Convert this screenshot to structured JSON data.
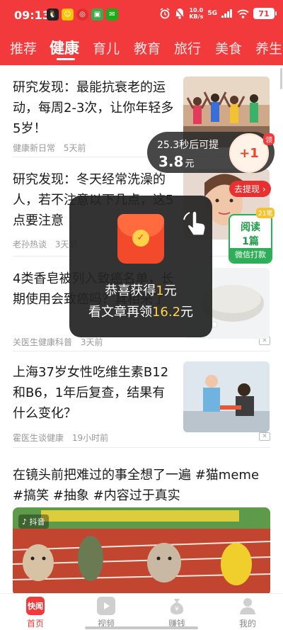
{
  "status_bar": {
    "time": "09:13",
    "speed_value": "10.0",
    "speed_unit": "KB/s",
    "signal": "5G",
    "battery": "71"
  },
  "tabs": [
    {
      "label": "推荐",
      "active": false
    },
    {
      "label": "健康",
      "active": true
    },
    {
      "label": "育儿",
      "active": false
    },
    {
      "label": "教育",
      "active": false
    },
    {
      "label": "旅行",
      "active": false
    },
    {
      "label": "美食",
      "active": false
    },
    {
      "label": "养生",
      "active": false
    }
  ],
  "articles": [
    {
      "title": "研究发现：最能抗衰老的运动，每周2-3次，让你年轻多5岁！",
      "source": "健康新日常",
      "time": "5天前"
    },
    {
      "title": "研究发现：冬天经常洗澡的人，若不注意以下几点，这5点要注意",
      "source": "老孙热谈",
      "time": "3天前"
    },
    {
      "title": "4类香皂被列入致癌名单，长期使用会致癌吗？真相来了",
      "source": "关医生健康科普",
      "time": "3天前"
    },
    {
      "title": "上海37岁女性吃维生素B12和B6，1年后复查，结果有什么变化？",
      "source": "霍医生谈健康",
      "time": "19小时前"
    },
    {
      "title": "在镜头前把难过的事全想了一遍 #猫meme #搞笑 #抽象 #内容过于真实",
      "video_tag": "抖音"
    }
  ],
  "floating_timer": {
    "countdown_text": "25.3秒后可提",
    "amount": "3.8",
    "unit": "元",
    "plus_label": "+1",
    "claim_label": "领"
  },
  "withdraw_button": "去提现",
  "read_task": {
    "line1": "阅读",
    "line2": "1篇",
    "footer": "微信打款",
    "badge": "21笔"
  },
  "toast": {
    "line1_prefix": "恭喜获得",
    "line1_value": "1",
    "line1_suffix": "元",
    "line2_prefix": "看文章再领",
    "line2_value": "16.2",
    "line2_suffix": "元"
  },
  "bottom_nav": [
    {
      "label": "首页",
      "icon": "kuaiwen-logo-icon",
      "icon_text": "快闻",
      "active": true
    },
    {
      "label": "视频",
      "icon": "play-icon",
      "active": false
    },
    {
      "label": "赚钱",
      "icon": "money-bag-icon",
      "active": false
    },
    {
      "label": "我的",
      "icon": "person-icon",
      "active": false
    }
  ],
  "colors": {
    "brand_red": "#f23a3c",
    "green": "#2fae59",
    "highlight_yellow": "#ffd34d"
  }
}
